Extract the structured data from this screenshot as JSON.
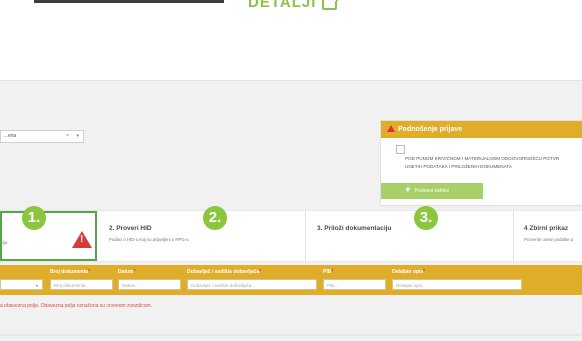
{
  "details": {
    "label": "DETALJI"
  },
  "doc_select": {
    "value": "…ena",
    "clear": "×",
    "arrow": "▾"
  },
  "submit": {
    "header": "Podnošenje prijave",
    "statement_line1": "POD PUNOM KRIVIČNOM I MATERIJALNOM ODGOVORNOŠĆU POTVR",
    "statement_line2": "UNETIH PODATAKA I PRILOŽENIH DOKUMENATA",
    "button": "Podnesi zahtev",
    "button_icon": "upload-icon"
  },
  "steps": [
    {
      "badge": "1.",
      "title": "",
      "desc": "cija"
    },
    {
      "badge": "2.",
      "title": "2. Proveri HID",
      "desc": "Podaci o HID-u koji su prijavljeni u RPG-u"
    },
    {
      "badge": "3.",
      "title": "3. Priloži dokumentaciju",
      "desc": ""
    },
    {
      "title": "4 Zbirni prikaz",
      "desc": "Proverite unete podatke p"
    }
  ],
  "filters": {
    "broj_label": "Broj dokumenta",
    "broj_placeholder": "Broj dokumenta...",
    "datum_label": "Datum",
    "datum_placeholder": "Datum...",
    "dobavljac_label": "Dobavljač i sedište dobavljača",
    "dobavljac_placeholder": "Dobavljač i sedište dobavljača...",
    "pib_label": "PIB",
    "pib_placeholder": "PIB...",
    "opis_label": "Detaljan opis",
    "opis_placeholder": "Detaljan opis...",
    "select_arrow": "▾",
    "required_mark": "*"
  },
  "required_note": "a obavezna polja. Obavezna polja označena su crvenom zvezdicom."
}
